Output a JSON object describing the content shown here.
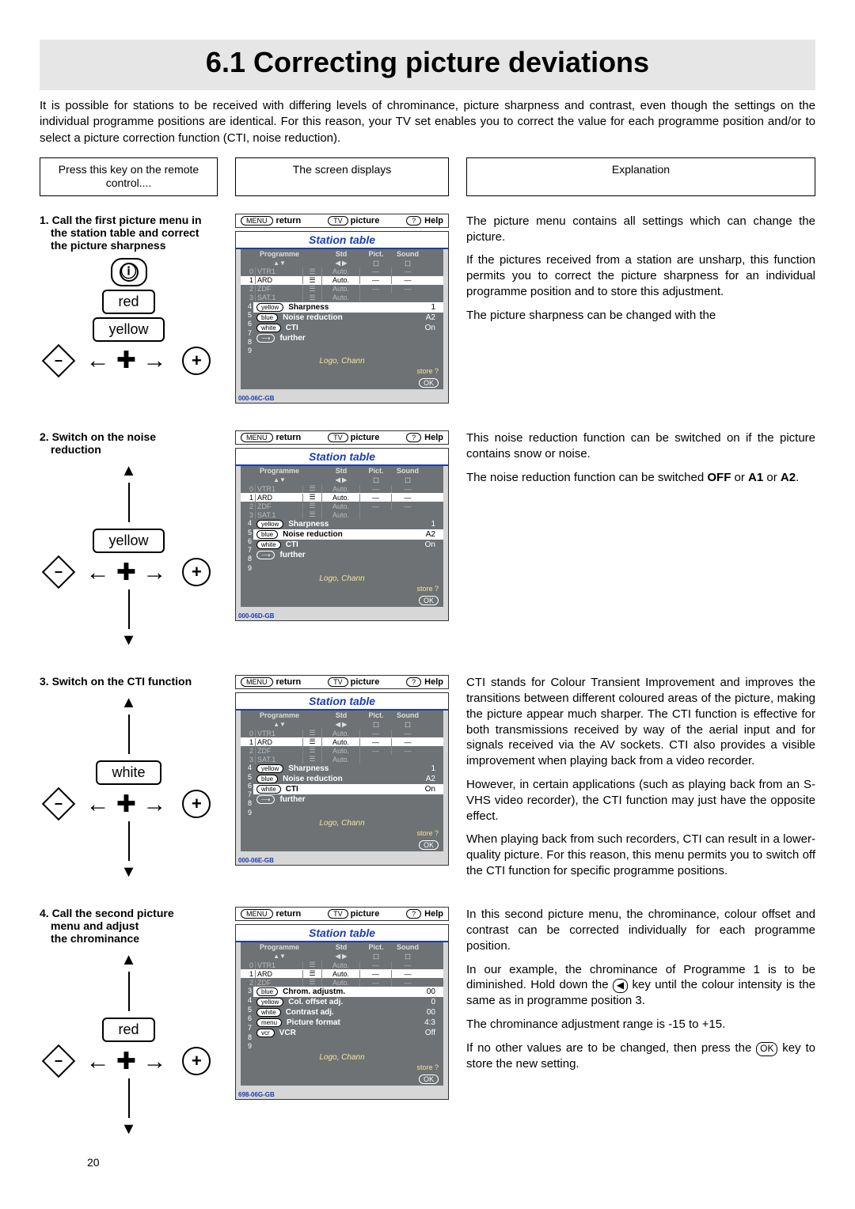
{
  "title": "6.1 Correcting picture deviations",
  "intro": "It is possible for stations to be received with differing levels of chrominance, picture sharpness and contrast, even though the settings on the individual programme positions are identical. For this reason, your TV set enables you to correct the value for each programme position and/or to select a picture correction function (CTI, noise reduction).",
  "col_headers": {
    "left": "Press this key on the remote control....",
    "mid": "The screen displays",
    "right": "Explanation"
  },
  "buttons": {
    "red": "red",
    "yellow": "yellow",
    "white": "white"
  },
  "screen_bar": {
    "return": "return",
    "picture": "picture",
    "help": "Help",
    "menu_pill": "MENU",
    "tv_pill": "TV",
    "q_pill": "?"
  },
  "station_table": {
    "title": "Station table",
    "head": {
      "prog": "Programme",
      "std": "Std",
      "pict": "Pict.",
      "sound": "Sound",
      "arrows": "▲▼",
      "lr": "◀ ▶"
    },
    "rows": [
      {
        "n": "0",
        "name": "VTR1",
        "std": "Auto.",
        "pict": "—",
        "snd": "—",
        "gray": true
      },
      {
        "n": "1",
        "name": "ARD",
        "std": "Auto.",
        "pict": "—",
        "snd": "—",
        "sel": true
      },
      {
        "n": "2",
        "name": "ZDF",
        "std": "Auto.",
        "pict": "—",
        "snd": "—",
        "gray": true
      },
      {
        "n": "3",
        "name": "SAT.1",
        "std": "Auto.",
        "pict": "",
        "snd": "",
        "gray": true
      }
    ],
    "numbers_only": [
      "4",
      "5",
      "6",
      "7",
      "8",
      "9"
    ],
    "menu1": [
      {
        "pill": "yellow",
        "label": "Sharpness",
        "val": "1"
      },
      {
        "pill": "blue",
        "label": "Noise reduction",
        "val": "A2"
      },
      {
        "pill": "white",
        "label": "CTI",
        "val": "On"
      }
    ],
    "further_pill": "⟶",
    "further": "further",
    "logo": "Logo, Chann",
    "store": "store ?",
    "ok": "OK"
  },
  "menu2": [
    {
      "pill": "blue",
      "label": "Chrom. adjustm.",
      "val": "00",
      "sel": true
    },
    {
      "pill": "yellow",
      "label": "Col. offset adj.",
      "val": "0"
    },
    {
      "pill": "white",
      "label": "Contrast adj.",
      "val": "00"
    },
    {
      "pill": "menu",
      "label": "Picture format",
      "val": "4:3"
    },
    {
      "pill": "vcr",
      "label": "VCR",
      "val": "Off"
    }
  ],
  "screen_ids": {
    "s1": "000-06C-GB",
    "s2": "000-06D-GB",
    "s3": "000-06E-GB",
    "s4": "698-06G-GB"
  },
  "steps": {
    "s1_num": "1.",
    "s1a": "Call the first picture menu in",
    "s1b": "the station table and correct",
    "s1c": "the picture sharpness",
    "s2_num": "2.",
    "s2a": "Switch on the noise",
    "s2b": "reduction",
    "s3_num": "3.",
    "s3a": "Switch on the CTI function",
    "s4_num": "4.",
    "s4a": "Call the second picture",
    "s4b": "menu and adjust",
    "s4c": "the chrominance"
  },
  "expl": {
    "e1a": "The picture menu contains all settings which can change the picture.",
    "e1b": "If the pictures received from a station are unsharp, this function permits you to correct the picture sharpness for an individual programme position and to store this adjustment.",
    "e1c": "The picture sharpness can be changed with the",
    "e2a": "This noise reduction function can be switched on if the picture contains snow or noise.",
    "e2b_pre": "The noise reduction function can be switched ",
    "e2b_off": "OFF",
    "e2b_mid": " or ",
    "e2b_a1": "A1",
    "e2b_mid2": " or ",
    "e2b_a2": "A2",
    "e2b_end": ".",
    "e3a": "CTI stands for Colour Transient Improvement and improves the transitions between different coloured areas of the picture, making the picture appear much sharper. The CTI function is effective for both transmissions received by way of the aerial input and for signals received via the AV sockets. CTI also provides a visible improvement when playing back from a video recorder.",
    "e3b": "However, in certain applications (such as playing back from an S-VHS video recorder), the CTI function may just have the opposite effect.",
    "e3c": "When playing back from such recorders, CTI can result in a lower-quality picture. For this reason, this menu permits you to switch off the CTI function for specific programme positions.",
    "e4a": "In this second picture menu, the chrominance, colour offset and contrast can be corrected individually for each programme position.",
    "e4b_pre": "In our example, the chrominance of Programme 1 is to be diminished. Hold down the ",
    "e4b_key": "◀",
    "e4b_post": " key until the colour intensity is the same as in programme position 3.",
    "e4c": "The chrominance adjustment range is -15 to +15.",
    "e4d_pre": "If no other values are to be changed, then press the ",
    "e4d_ok": "OK",
    "e4d_post": " key to store the new setting."
  },
  "page_no": "20"
}
